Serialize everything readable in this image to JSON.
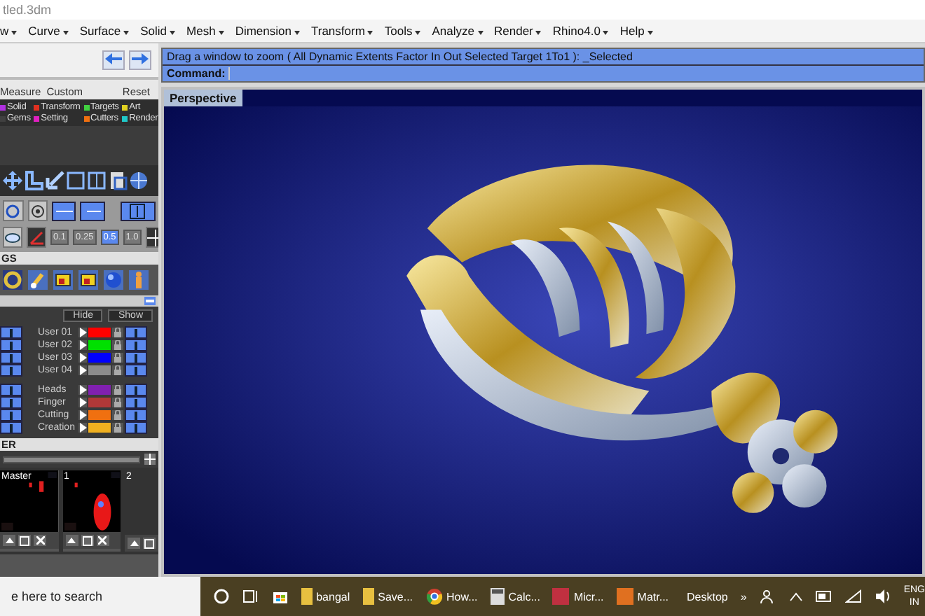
{
  "window": {
    "title": "tled.3dm"
  },
  "menu": [
    "w",
    "Curve",
    "Surface",
    "Solid",
    "Mesh",
    "Dimension",
    "Transform",
    "Tools",
    "Analyze",
    "Render",
    "Rhino4.0",
    "Help"
  ],
  "command": {
    "prompt": "Drag a window to zoom ( All  Dynamic  Extents  Factor  In  Out  Selected  Target  1To1 ): _Selected",
    "label": "Command:"
  },
  "viewport": {
    "title": "Perspective",
    "kind": "picture"
  },
  "panel_tabs": [
    "Measure",
    "Custom",
    "Reset"
  ],
  "categories": [
    {
      "label": "Solid",
      "color": "#b030e0"
    },
    {
      "label": "Transform",
      "color": "#e03020"
    },
    {
      "label": "Targets",
      "color": "#40d040"
    },
    {
      "label": "Art",
      "color": "#e0d020"
    },
    {
      "label": "Gems",
      "color": "#404040"
    },
    {
      "label": "Setting",
      "color": "#e020c0"
    },
    {
      "label": "Cutters",
      "color": "#f07010"
    },
    {
      "label": "Render",
      "color": "#20c8c8"
    }
  ],
  "precision": [
    {
      "label": "0.1",
      "selected": false
    },
    {
      "label": "0.25",
      "selected": false
    },
    {
      "label": "0.5",
      "selected": true
    },
    {
      "label": "1.0",
      "selected": false
    }
  ],
  "section_1": "GS",
  "layer_buttons": [
    "Hide",
    "Show"
  ],
  "layers": [
    {
      "name": "User 01",
      "color": "#ff0000"
    },
    {
      "name": "User 02",
      "color": "#00e000"
    },
    {
      "name": "User 03",
      "color": "#0000ff"
    },
    {
      "name": "User 04",
      "color": "#8c8c8c"
    },
    {
      "name": "Heads",
      "color": "#8020b0"
    },
    {
      "name": "Finger",
      "color": "#b03838"
    },
    {
      "name": "Cutting",
      "color": "#f07010"
    },
    {
      "name": "Creation",
      "color": "#f0b020"
    }
  ],
  "section_2": "ER",
  "thumbnails": [
    {
      "label": "Master",
      "kind": "picture"
    },
    {
      "label": "1",
      "kind": "picture"
    },
    {
      "label": "2"
    }
  ],
  "taskbar": {
    "search": "e here to search",
    "apps": [
      {
        "kind": "folder",
        "label": "bangal"
      },
      {
        "kind": "folder",
        "label": "Save..."
      },
      {
        "kind": "browser",
        "label": "How..."
      },
      {
        "kind": "calculator",
        "label": "Calc..."
      },
      {
        "kind": "app",
        "label": "Micr..."
      },
      {
        "kind": "matrix",
        "label": "Matr..."
      }
    ],
    "desktop": "Desktop",
    "more": "»",
    "language": "ENG",
    "region": "IN"
  }
}
